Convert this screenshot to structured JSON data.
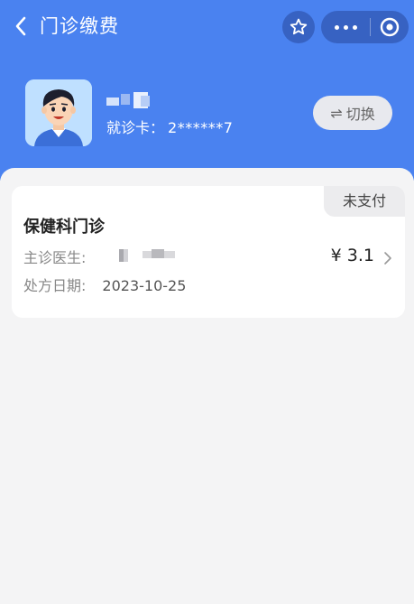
{
  "header": {
    "title": "门诊缴费",
    "back_icon": "chevron-left-icon",
    "star_icon": "star-icon",
    "more_icon": "more-dots-icon",
    "close_icon": "target-close-icon",
    "bg_color": "#4a82f0"
  },
  "patient": {
    "card_label": "就诊卡：",
    "card_number": "2******7",
    "switch_label": "切换",
    "switch_icon": "switch-arrows-icon"
  },
  "bills": [
    {
      "status": "未支付",
      "department": "保健科门诊",
      "doctor_label": "主诊医生:",
      "date_label": "处方日期:",
      "date": "2023-10-25",
      "amount": "¥ 3.1"
    }
  ]
}
